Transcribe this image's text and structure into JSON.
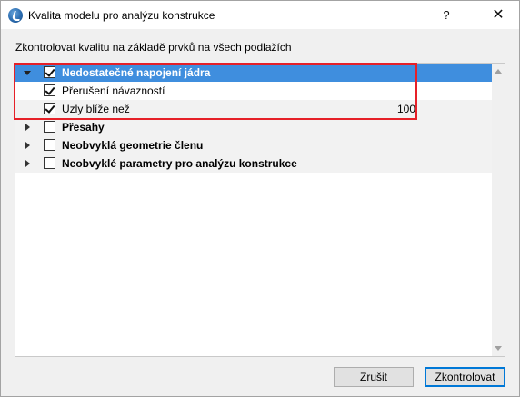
{
  "window": {
    "title": "Kvalita modelu pro analýzu konstrukce",
    "help_label": "?",
    "close_label": "✕"
  },
  "instruction": "Zkontrolovat kvalitu na základě prvků na všech podlažích",
  "tree": {
    "rows": [
      {
        "label": "Nedostatečné napojení jádra",
        "value": "",
        "checked": true,
        "expanded": true,
        "selected": true,
        "bold": true,
        "level": 0
      },
      {
        "label": "Přerušení návazností",
        "value": "",
        "checked": true,
        "level": 1
      },
      {
        "label": "Uzly blíže než",
        "value": "100",
        "checked": true,
        "level": 1
      },
      {
        "label": "Přesahy",
        "value": "",
        "checked": false,
        "expanded": false,
        "bold": true,
        "level": 0
      },
      {
        "label": "Neobvyklá geometrie členu",
        "value": "",
        "checked": false,
        "expanded": false,
        "bold": true,
        "level": 0
      },
      {
        "label": "Neobvyklé parametry pro analýzu konstrukce",
        "value": "",
        "checked": false,
        "expanded": false,
        "bold": true,
        "level": 0
      }
    ]
  },
  "buttons": {
    "cancel": "Zrušit",
    "check": "Zkontrolovat"
  },
  "colors": {
    "selection": "#3f8ede",
    "highlight": "#e62028",
    "default_button_border": "#0078d7"
  }
}
